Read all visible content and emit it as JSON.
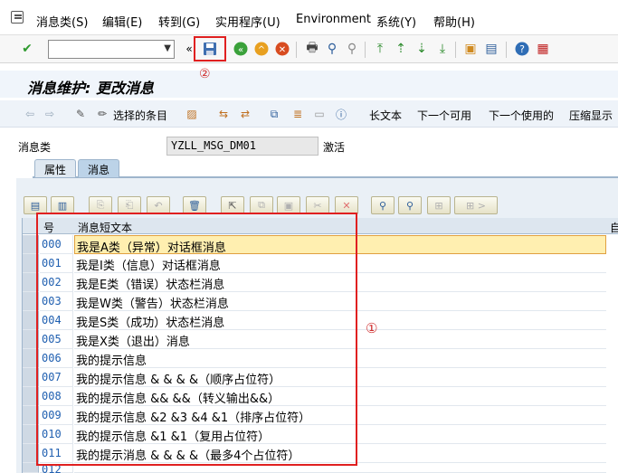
{
  "menu": {
    "items": [
      "消息类(S)",
      "编辑(E)",
      "转到(G)",
      "实用程序(U)",
      "Environment",
      "系统(Y)",
      "帮助(H)"
    ]
  },
  "title": "消息维护: 更改消息",
  "app_toolbar": {
    "selected_entries": "选择的条目",
    "long_text": "长文本",
    "next_available": "下一个可用",
    "next_used": "下一个使用的",
    "compress_display": "压缩显示"
  },
  "header": {
    "message_class_label": "消息类",
    "message_class_value": "YZLL_MSG_DM01",
    "status": "激活"
  },
  "tabs": [
    "属性",
    "消息"
  ],
  "table": {
    "col_num": "号",
    "col_text": "消息短文本",
    "col_self": "自",
    "rows": [
      {
        "num": "000",
        "text": "我是A类（异常）对话框消息"
      },
      {
        "num": "001",
        "text": "我是I类（信息）对话框消息"
      },
      {
        "num": "002",
        "text": "我是E类（错误）状态栏消息"
      },
      {
        "num": "003",
        "text": "我是W类（警告）状态栏消息"
      },
      {
        "num": "004",
        "text": "我是S类（成功）状态栏消息"
      },
      {
        "num": "005",
        "text": "我是X类（退出）消息"
      },
      {
        "num": "006",
        "text": "我的提示信息"
      },
      {
        "num": "007",
        "text": "我的提示信息 & & & &（顺序占位符）"
      },
      {
        "num": "008",
        "text": "我的提示信息 && &&（转义输出&&）"
      },
      {
        "num": "009",
        "text": "我的提示信息 &2 &3 &4 &1（排序占位符）"
      },
      {
        "num": "010",
        "text": "我的提示信息 &1 &1（复用占位符）"
      },
      {
        "num": "011",
        "text": "我的提示消息 & & & &（最多4个占位符）"
      },
      {
        "num": "012",
        "text": ""
      }
    ]
  },
  "annotations": {
    "one": "①",
    "two": "②"
  },
  "colors": {
    "annotation_red": "#e02020",
    "number_blue": "#1f5fb0",
    "highlight": "#ffefb0"
  }
}
